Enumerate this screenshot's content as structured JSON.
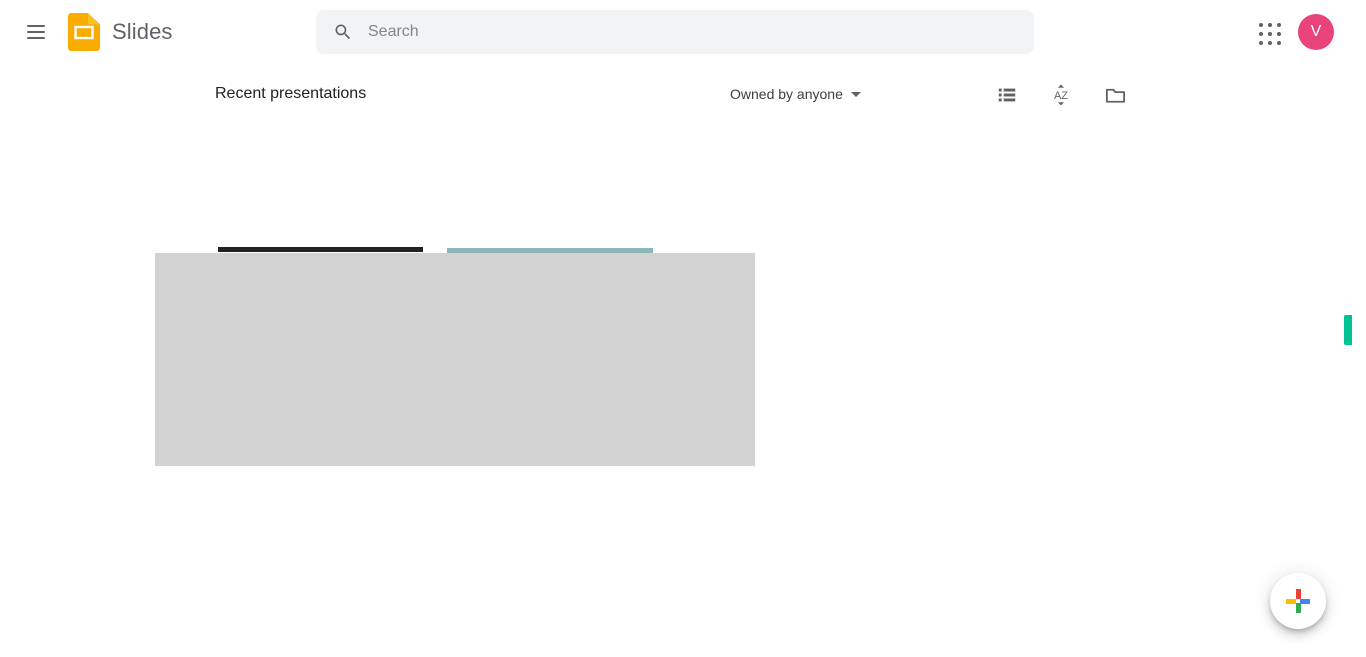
{
  "header": {
    "menu_icon": "hamburger-menu-icon",
    "brand_title": "Slides",
    "brand_logo_icon": "google-slides-logo-icon",
    "search": {
      "icon": "search-icon",
      "placeholder": "Search",
      "value": ""
    },
    "apps_launcher_icon": "apps-grid-icon",
    "avatar": {
      "initial": "V",
      "color": "#e8437a"
    }
  },
  "toolbar": {
    "section_title": "Recent presentations",
    "owner_filter": {
      "label": "Owned by anyone",
      "caret_icon": "chevron-down-icon"
    },
    "icons": [
      {
        "name": "list-view-icon",
        "label": "List view"
      },
      {
        "name": "sort-az-icon",
        "label": "AZ",
        "sort_text": "AZ"
      },
      {
        "name": "folder-icon",
        "label": "Open file picker"
      }
    ]
  },
  "content": {
    "loading_bars": [
      {
        "name": "loading-bar-dark",
        "color": "#202124"
      },
      {
        "name": "loading-bar-teal",
        "color": "#8cb6b8"
      }
    ],
    "placeholder_block": {
      "name": "thumbnail-placeholder",
      "color": "#d2d2d2"
    }
  },
  "edge_tab": {
    "name": "side-panel-tab",
    "color": "#00c194"
  },
  "fab": {
    "name": "new-presentation-button",
    "icon": "google-plus-icon",
    "colors": {
      "top": "#ea4335",
      "bottom": "#34a853",
      "left": "#fbbc04",
      "right": "#4285f4"
    }
  }
}
